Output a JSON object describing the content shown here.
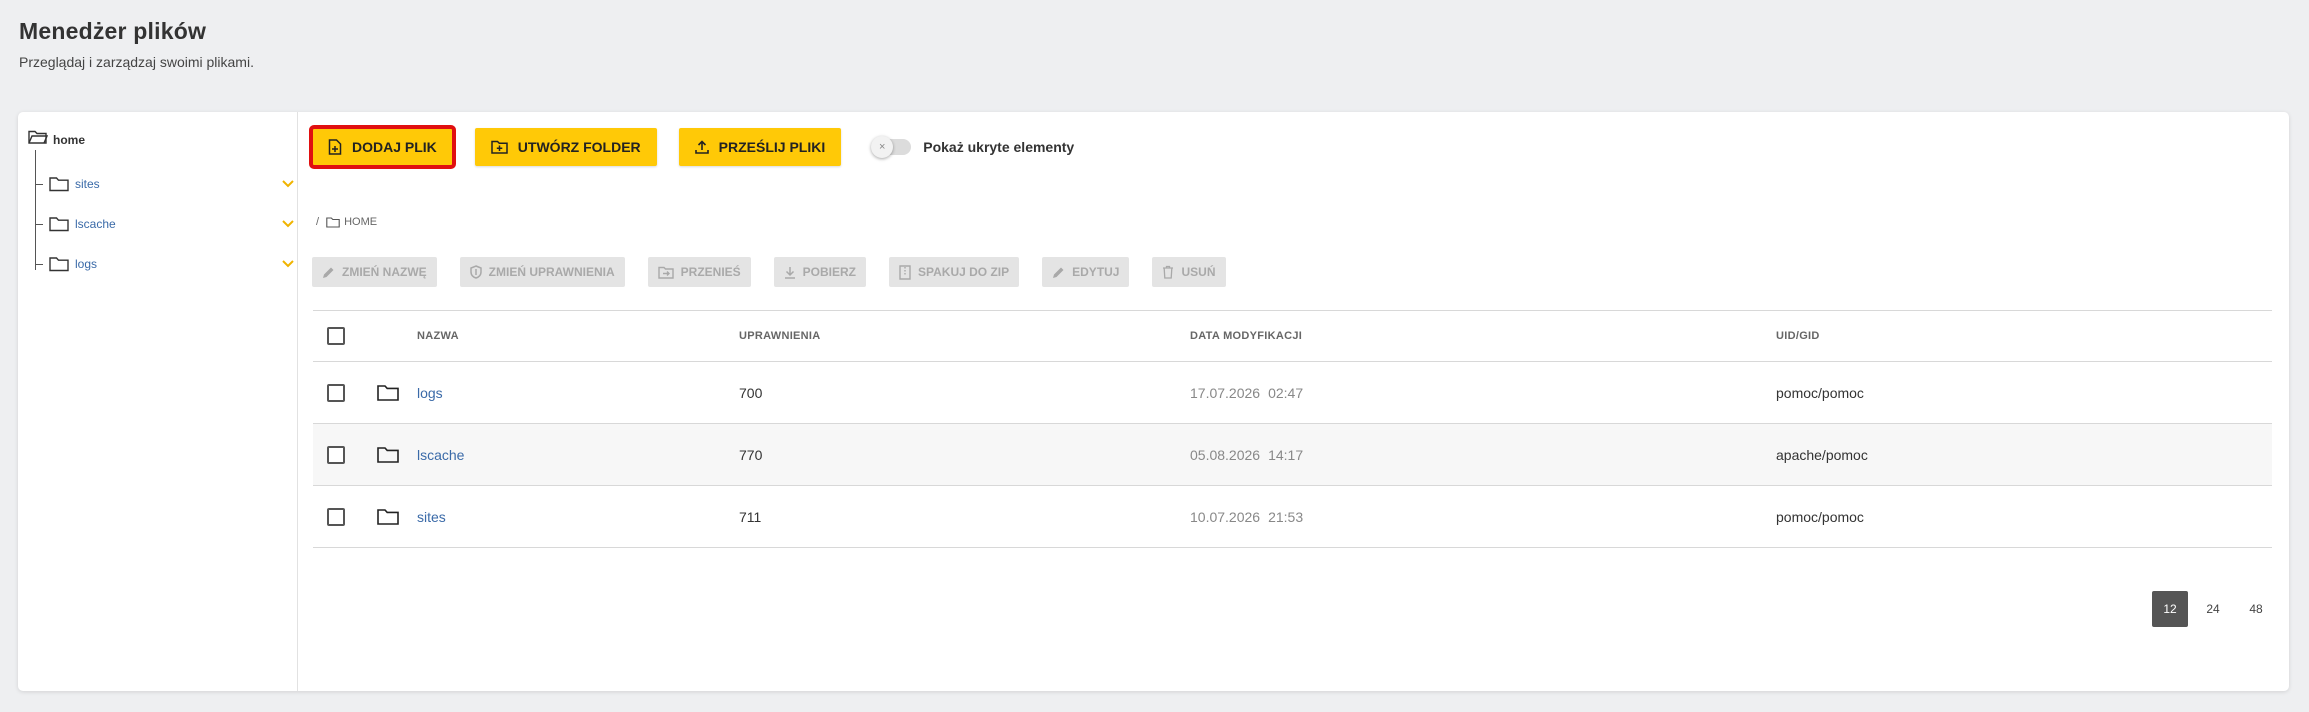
{
  "page": {
    "title": "Menedżer plików",
    "subtitle": "Przeglądaj i zarządzaj swoimi plikami."
  },
  "tree": {
    "root": "home",
    "items": [
      {
        "label": "sites"
      },
      {
        "label": "lscache"
      },
      {
        "label": "logs"
      }
    ]
  },
  "toolbar": {
    "add_file": "DODAJ PLIK",
    "create_folder": "UTWÓRZ FOLDER",
    "upload_files": "PRZEŚLIJ PLIKI",
    "show_hidden": "Pokaż ukryte elementy"
  },
  "breadcrumb": {
    "separator": "/",
    "current": "HOME"
  },
  "actions": {
    "rename": "ZMIEŃ NAZWĘ",
    "permissions": "ZMIEŃ UPRAWNIENIA",
    "move": "PRZENIEŚ",
    "download": "POBIERZ",
    "zip": "SPAKUJ DO ZIP",
    "edit": "EDYTUJ",
    "delete": "USUŃ"
  },
  "table": {
    "headers": {
      "name": "NAZWA",
      "permissions": "UPRAWNIENIA",
      "modified": "DATA MODYFIKACJI",
      "uid": "UID/GID"
    },
    "rows": [
      {
        "name": "logs",
        "permissions": "700",
        "date": "17.07.2026",
        "time": "02:47",
        "uid": "pomoc/pomoc"
      },
      {
        "name": "lscache",
        "permissions": "770",
        "date": "05.08.2026",
        "time": "14:17",
        "uid": "apache/pomoc"
      },
      {
        "name": "sites",
        "permissions": "711",
        "date": "10.07.2026",
        "time": "21:53",
        "uid": "pomoc/pomoc"
      }
    ]
  },
  "pagination": {
    "options": [
      "12",
      "24",
      "48"
    ],
    "active": "12"
  },
  "colors": {
    "accent": "#ffc907",
    "highlight": "#e01010",
    "link": "#3a6aa8",
    "chevron": "#f0b400"
  }
}
